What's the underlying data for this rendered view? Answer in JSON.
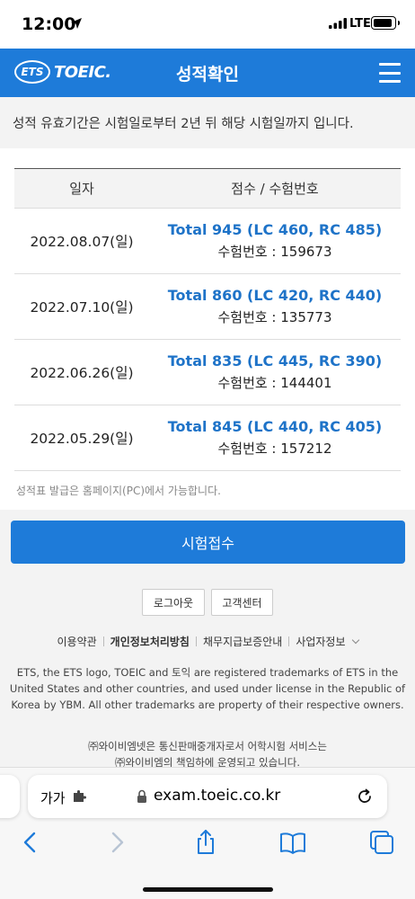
{
  "status_bar": {
    "time": "12:00",
    "network": "LTE"
  },
  "header": {
    "logo_ets": "ETS",
    "logo_toeic": "TOEIC.",
    "title": "성적확인"
  },
  "notice": {
    "text": "성적 유효기간은 시험일로부터 2년 뒤 해당 시험일까지 입니다."
  },
  "table": {
    "headers": {
      "date": "일자",
      "score": "점수 / 수험번호"
    },
    "rows": [
      {
        "date": "2022.08.07(일)",
        "total": "Total 945 (LC 460, RC 485)",
        "exam_no": "수험번호 : 159673"
      },
      {
        "date": "2022.07.10(일)",
        "total": "Total 860 (LC 420, RC 440)",
        "exam_no": "수험번호 : 135773"
      },
      {
        "date": "2022.06.26(일)",
        "total": "Total 835 (LC 445, RC 390)",
        "exam_no": "수험번호 : 144401"
      },
      {
        "date": "2022.05.29(일)",
        "total": "Total 845 (LC 440, RC 405)",
        "exam_no": "수험번호 : 157212"
      }
    ]
  },
  "issue_note": "성적표 발급은 홈페이지(PC)에서 가능합니다.",
  "footer": {
    "apply_button": "시험접수",
    "logout_button": "로그아웃",
    "customer_center_button": "고객센터",
    "links": {
      "terms": "이용약관",
      "privacy": "개인정보처리방침",
      "debt_guarantee": "채무지급보증안내",
      "business_info": "사업자정보"
    },
    "trademark": "ETS, the ETS logo, TOEIC and 토익 are registered trademarks of ETS in the United States and other countries, and used under license in the Republic of Korea by YBM. All other trademarks are property of their respective owners.",
    "ybm_line1": "㈜와이비엠넷은 통신판매중개자로서 어학시험 서비스는",
    "ybm_line2": "㈜와이비엠의 책임하에 운영되고 있습니다."
  },
  "browser": {
    "text_size": "가가",
    "url": "exam.toeic.co.kr"
  },
  "colors": {
    "brand": "#1e7bd9",
    "score_text": "#1e73c8"
  }
}
